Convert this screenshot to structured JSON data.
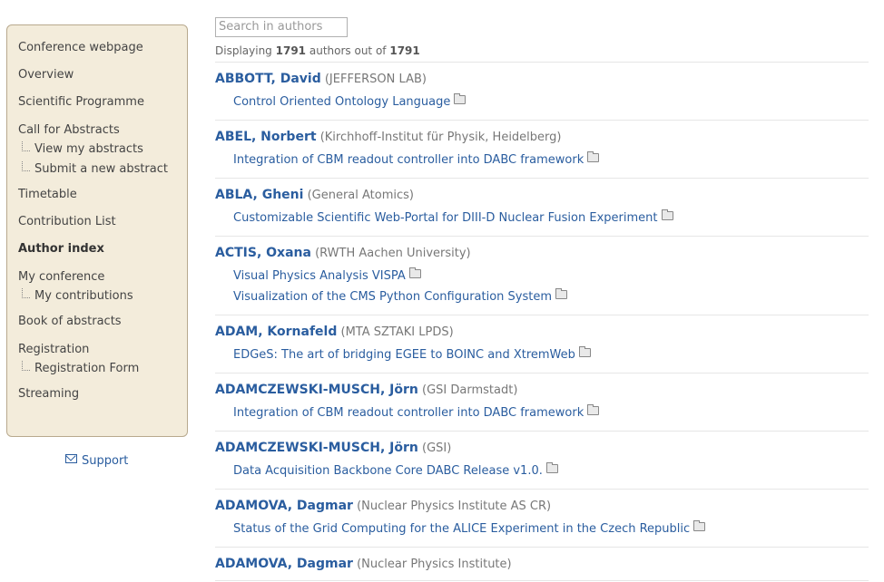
{
  "sidebar": {
    "items": [
      {
        "label": "Conference webpage"
      },
      {
        "label": "Overview"
      },
      {
        "label": "Scientific Programme"
      },
      {
        "label": "Call for Abstracts"
      },
      {
        "label": "View my abstracts"
      },
      {
        "label": "Submit a new abstract"
      },
      {
        "label": "Timetable"
      },
      {
        "label": "Contribution List"
      },
      {
        "label": "Author index"
      },
      {
        "label": "My conference"
      },
      {
        "label": "My contributions"
      },
      {
        "label": "Book of abstracts"
      },
      {
        "label": "Registration"
      },
      {
        "label": "Registration Form"
      },
      {
        "label": "Streaming"
      }
    ],
    "support_label": "Support"
  },
  "search": {
    "placeholder": "Search in authors"
  },
  "count": {
    "prefix": "Displaying",
    "shown": "1791",
    "middle": "authors out of",
    "total": "1791"
  },
  "authors": [
    {
      "name": "ABBOTT, David",
      "affiliation": "(JEFFERSON LAB)",
      "contributions": [
        "Control Oriented Ontology Language"
      ]
    },
    {
      "name": "ABEL, Norbert",
      "affiliation": "(Kirchhoff-Institut für Physik, Heidelberg)",
      "contributions": [
        "Integration of CBM readout controller into DABC framework"
      ]
    },
    {
      "name": "ABLA, Gheni",
      "affiliation": "(General Atomics)",
      "contributions": [
        "Customizable Scientific Web-Portal for DIII-D Nuclear Fusion Experiment"
      ]
    },
    {
      "name": "ACTIS, Oxana",
      "affiliation": "(RWTH Aachen University)",
      "contributions": [
        "Visual Physics Analysis VISPA",
        "Visualization of the CMS Python Configuration System"
      ]
    },
    {
      "name": "ADAM, Kornafeld",
      "affiliation": "(MTA SZTAKI LPDS)",
      "contributions": [
        "EDGeS: The art of bridging EGEE to BOINC and XtremWeb"
      ]
    },
    {
      "name": "ADAMCZEWSKI-MUSCH, Jörn",
      "affiliation": "(GSI Darmstadt)",
      "contributions": [
        "Integration of CBM readout controller into DABC framework"
      ]
    },
    {
      "name": "ADAMCZEWSKI-MUSCH, Jörn",
      "affiliation": "(GSI)",
      "contributions": [
        "Data Acquisition Backbone Core DABC Release v1.0."
      ]
    },
    {
      "name": "ADAMOVA, Dagmar",
      "affiliation": "(Nuclear Physics Institute AS CR)",
      "contributions": [
        "Status of the Grid Computing for the ALICE Experiment in the Czech Republic"
      ]
    },
    {
      "name": "ADAMOVA, Dagmar",
      "affiliation": "(Nuclear Physics Institute)",
      "contributions": []
    }
  ]
}
